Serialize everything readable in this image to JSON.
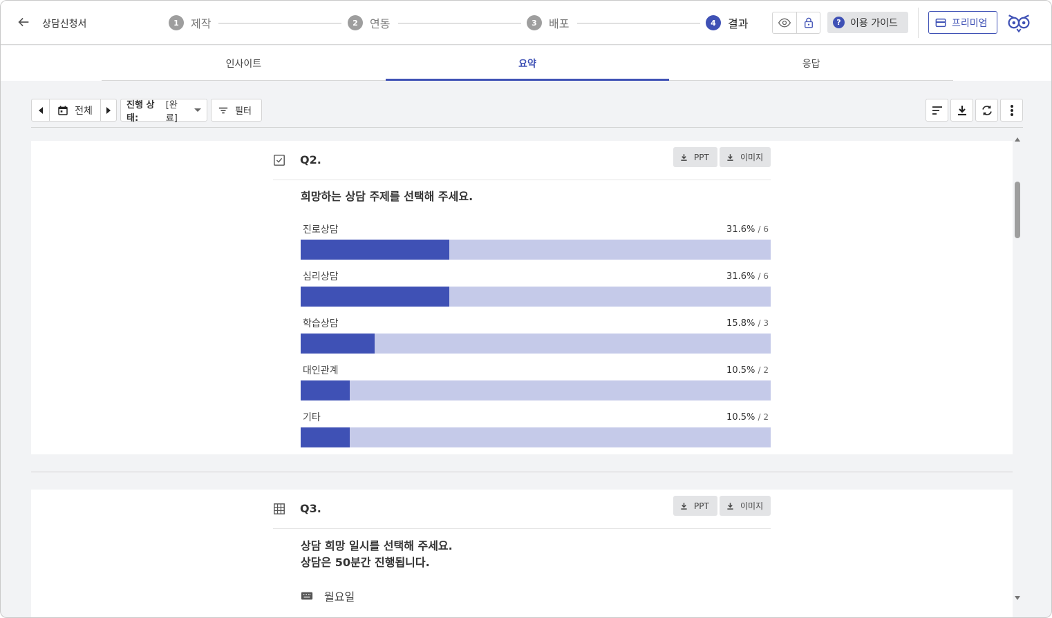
{
  "header": {
    "title": "상담신청서",
    "steps": [
      {
        "num": "1",
        "label": "제작"
      },
      {
        "num": "2",
        "label": "연동"
      },
      {
        "num": "3",
        "label": "배포"
      },
      {
        "num": "4",
        "label": "결과"
      }
    ],
    "guide_label": "이용 가이드",
    "guide_icon_text": "?",
    "premium_label": "프리미엄"
  },
  "tabs": [
    {
      "label": "인사이트"
    },
    {
      "label": "요약",
      "active": true
    },
    {
      "label": "응답"
    }
  ],
  "toolbar": {
    "range_label": "전체",
    "status_prefix": "진행 상태:",
    "status_value": "[완료]",
    "filter_label": "필터"
  },
  "questions": [
    {
      "number": "Q2.",
      "type_icon": "checkbox-icon",
      "ppt_label": "PPT",
      "image_label": "이미지",
      "text": "희망하는 상담 주제를 선택해 주세요.",
      "options": [
        {
          "name": "진로상담",
          "percent": "31.6%",
          "count": "/ 6",
          "ratio": 0.316
        },
        {
          "name": "심리상담",
          "percent": "31.6%",
          "count": "/ 6",
          "ratio": 0.316
        },
        {
          "name": "학습상담",
          "percent": "15.8%",
          "count": "/ 3",
          "ratio": 0.158
        },
        {
          "name": "대인관계",
          "percent": "10.5%",
          "count": "/ 2",
          "ratio": 0.105
        },
        {
          "name": "기타",
          "percent": "10.5%",
          "count": "/ 2",
          "ratio": 0.105
        }
      ]
    },
    {
      "number": "Q3.",
      "type_icon": "grid-icon",
      "ppt_label": "PPT",
      "image_label": "이미지",
      "text_line1": "상담 희망 일시를 선택해 주세요.",
      "text_line2": "상담은 50분간 진행됩니다.",
      "first_row": "월요일"
    }
  ],
  "colors": {
    "accent": "#3f51b5",
    "bar_bg": "#c5cae9",
    "page_bg": "#f2f3f5"
  }
}
